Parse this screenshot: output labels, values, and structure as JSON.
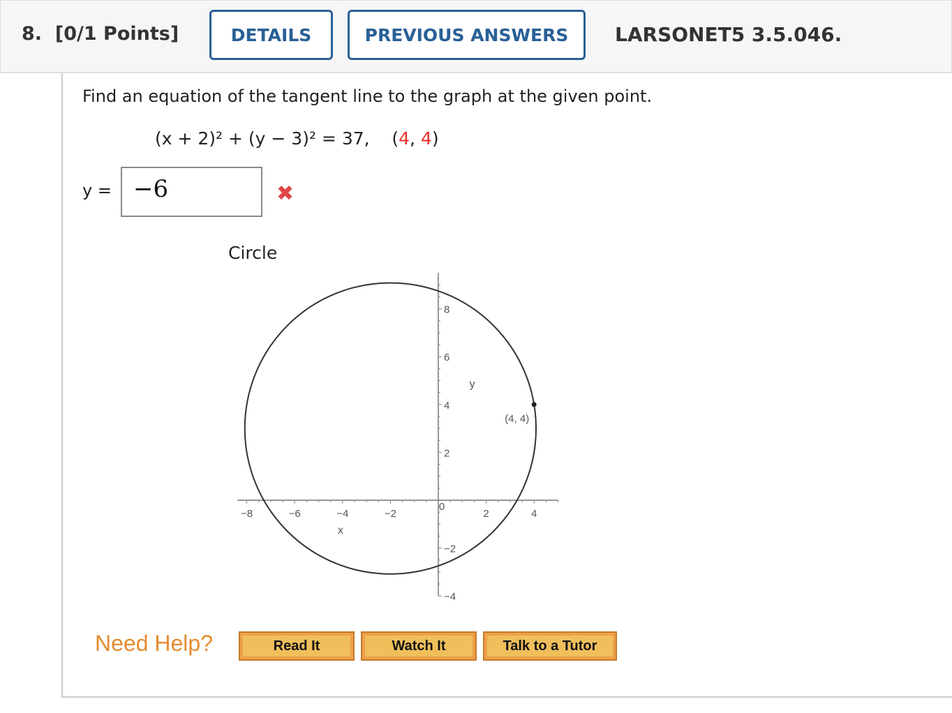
{
  "header": {
    "question_number": "8.",
    "points": "[0/1 Points]",
    "details_label": "DETAILS",
    "previous_answers_label": "PREVIOUS ANSWERS",
    "problem_code": "LARSONET5 3.5.046."
  },
  "question": {
    "prompt": "Find an equation of the tangent line to the graph at the given point.",
    "equation_left": "(x + 2)² + (y − 3)² = 37,",
    "point_x": "4",
    "point_y": "4",
    "answer_label": "y =",
    "answer_value": "−6",
    "result_icon": "incorrect-x-icon",
    "result_color": "#e04848",
    "accent_color": "#2a6096"
  },
  "figure": {
    "title": "Circle",
    "x_label": "x",
    "y_label": "y",
    "x_ticks": [
      "−8",
      "−6",
      "−4",
      "−2",
      "0",
      "2",
      "4"
    ],
    "y_ticks": [
      "8",
      "6",
      "4",
      "2",
      "−2",
      "−4"
    ],
    "circle": {
      "center": [
        -2,
        3
      ],
      "radius_squared": 37
    },
    "point": [
      4,
      4
    ],
    "point_label": "(4, 4)",
    "xlim": [
      -8.5,
      5
    ],
    "ylim": [
      -4,
      9.5
    ]
  },
  "help": {
    "label": "Need Help?",
    "buttons": [
      "Read It",
      "Watch It",
      "Talk to a Tutor"
    ]
  }
}
